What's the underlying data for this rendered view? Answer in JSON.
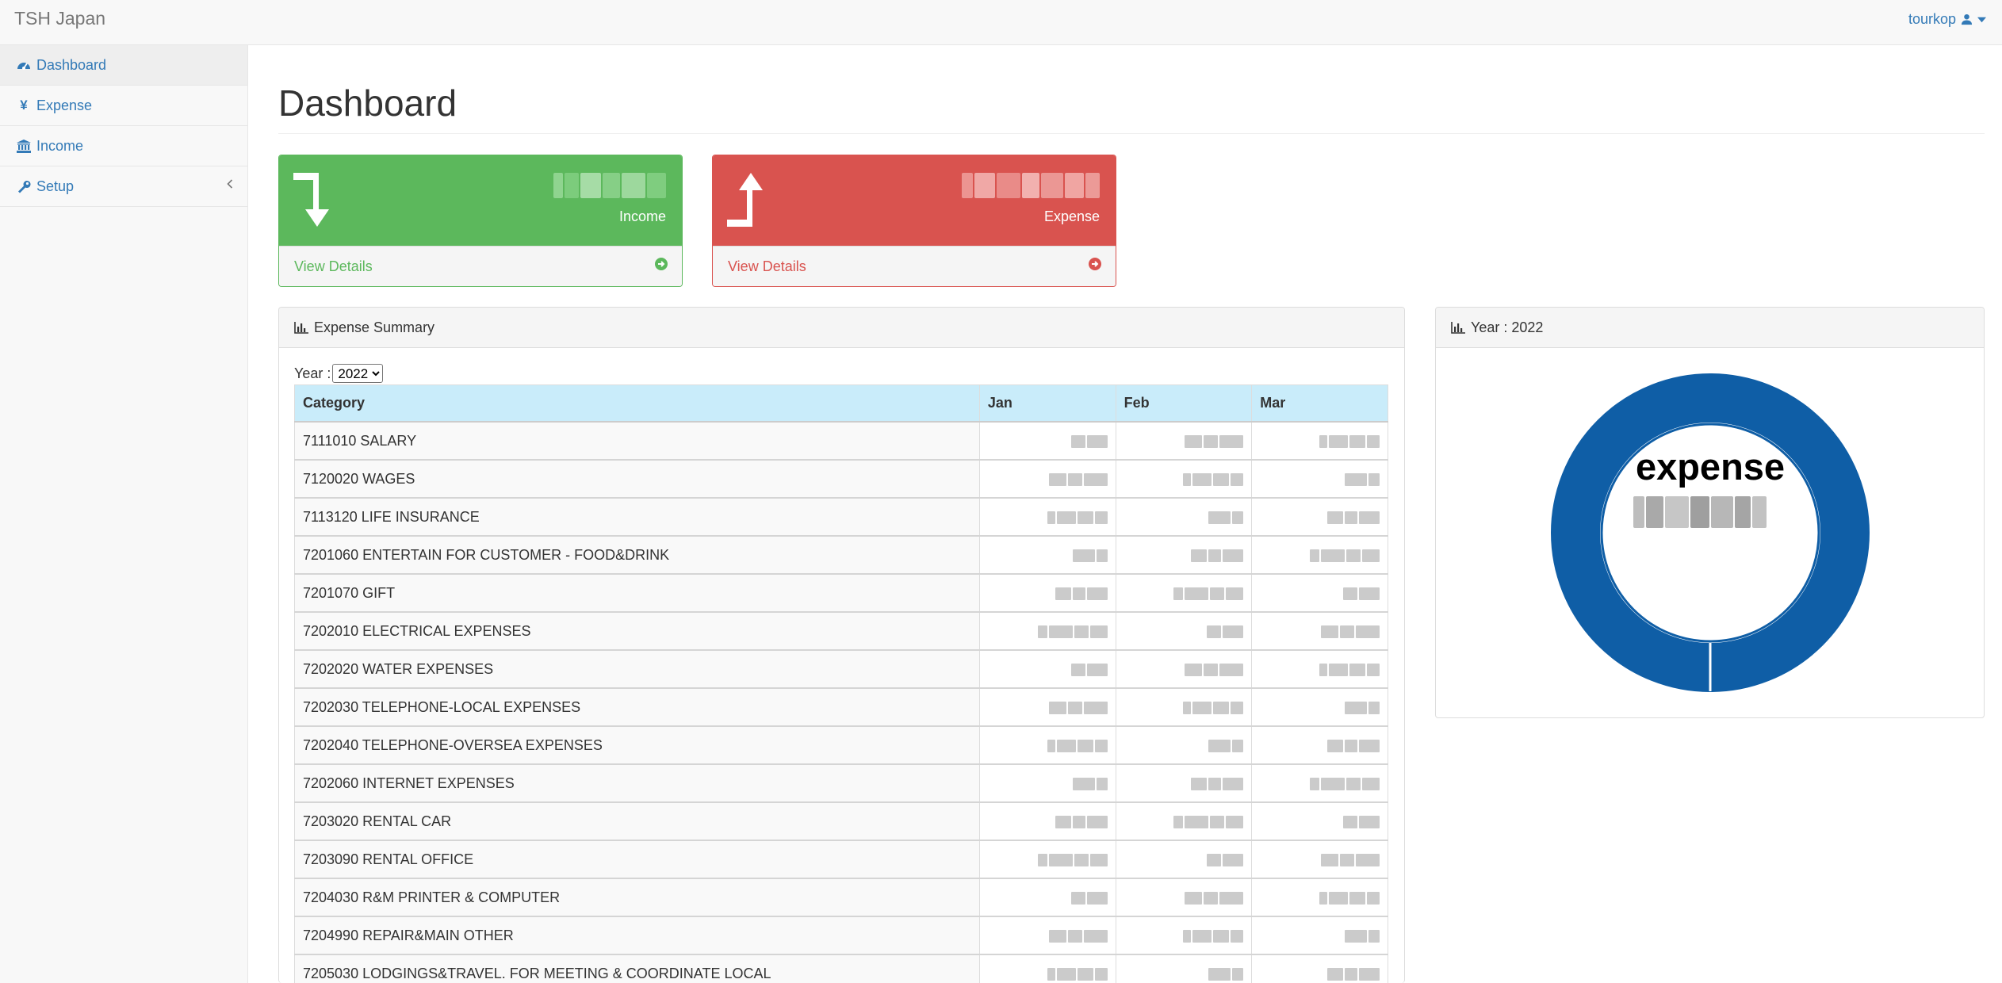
{
  "app": {
    "brand": "TSH Japan"
  },
  "user": {
    "name": "tourkop"
  },
  "sidebar": {
    "items": [
      {
        "label": "Dashboard",
        "icon": "dashboard-icon",
        "active": true
      },
      {
        "label": "Expense",
        "icon": "yen-icon"
      },
      {
        "label": "Income",
        "icon": "bank-icon"
      },
      {
        "label": "Setup",
        "icon": "wrench-icon",
        "has_submenu": true
      }
    ]
  },
  "page": {
    "title": "Dashboard"
  },
  "stats": {
    "income": {
      "caption": "Income",
      "link": "View Details",
      "color": "#5cb85c",
      "value_obscured": true
    },
    "expense": {
      "caption": "Expense",
      "link": "View Details",
      "color": "#d9534f",
      "value_obscured": true
    }
  },
  "summary": {
    "heading": "Expense Summary",
    "year_label": "Year :",
    "year_selected": "2022",
    "columns": [
      "Category",
      "Jan",
      "Feb",
      "Mar"
    ],
    "rows": [
      "7111010 SALARY",
      "7120020 WAGES",
      "7113120 LIFE INSURANCE",
      "7201060 ENTERTAIN FOR CUSTOMER - FOOD&DRINK",
      "7201070 GIFT",
      "7202010 ELECTRICAL EXPENSES",
      "7202020 WATER EXPENSES",
      "7202030 TELEPHONE-LOCAL EXPENSES",
      "7202040 TELEPHONE-OVERSEA EXPENSES",
      "7202060 INTERNET EXPENSES",
      "7203020 RENTAL CAR",
      "7203090 RENTAL OFFICE",
      "7204030 R&M PRINTER & COMPUTER",
      "7204990 REPAIR&MAIN OTHER",
      "7205030 LODGINGS&TRAVEL. FOR MEETING & COORDINATE LOCAL"
    ],
    "values_obscured": true
  },
  "year_panel": {
    "heading": "Year : 2022",
    "donut_label": "expense",
    "donut_color": "#0f5ea6",
    "value_obscured": true
  }
}
